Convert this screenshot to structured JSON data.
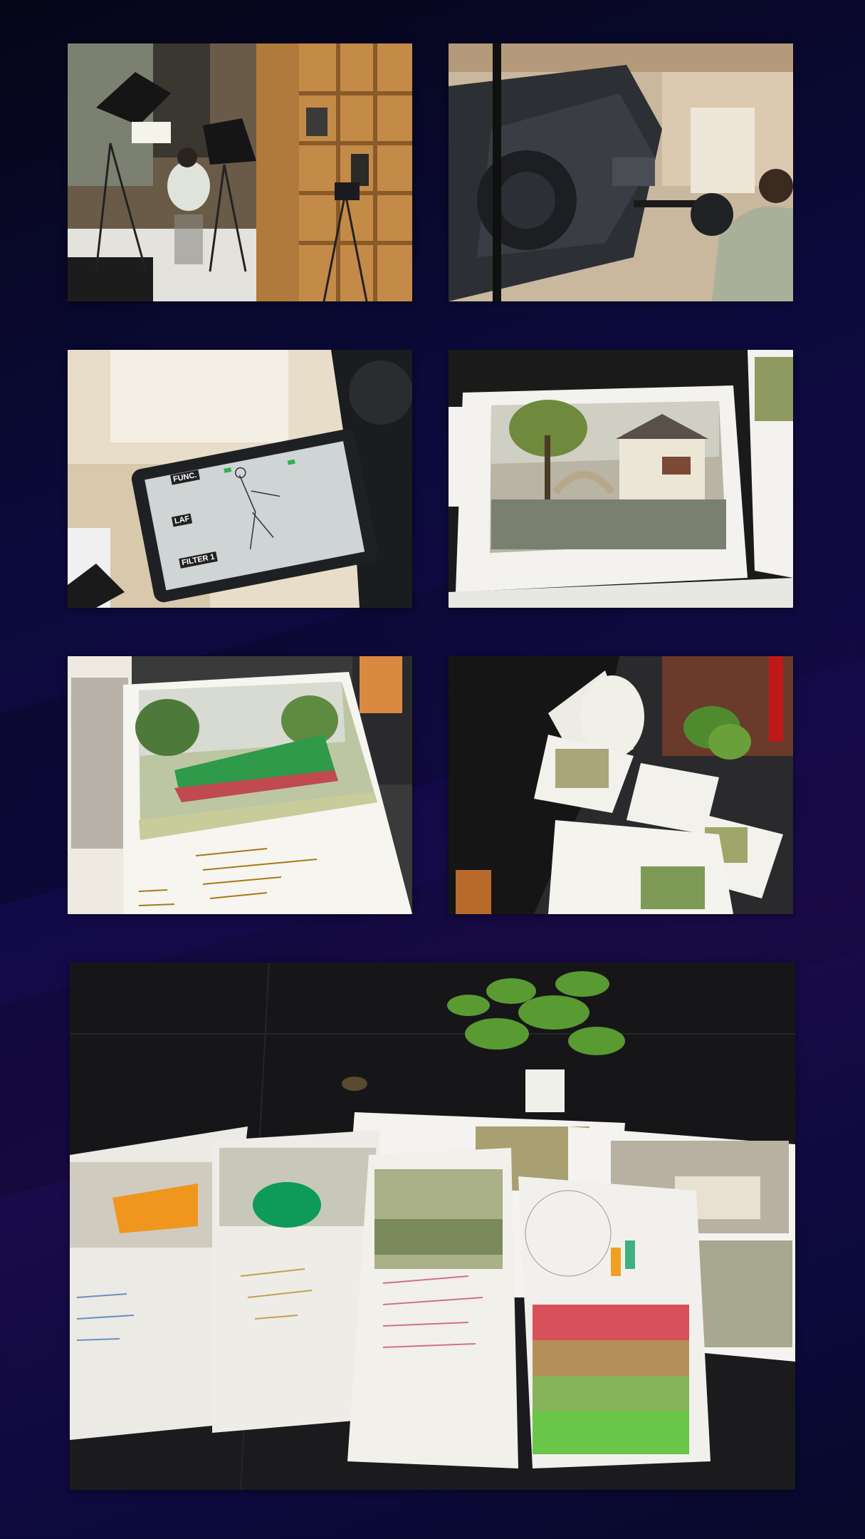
{
  "gallery": {
    "background_colors": [
      "#060618",
      "#120a48",
      "#1a0b4a"
    ],
    "photos": [
      {
        "name": "photo-studio-setup",
        "subject": "studio-lights-camera-tripod"
      },
      {
        "name": "photo-video-camera",
        "subject": "camcorder-recording-artist"
      },
      {
        "name": "photo-camera-screen",
        "subject": "camera-lcd-sketch"
      },
      {
        "name": "photo-village-painting",
        "subject": "gouache-bridge-village"
      },
      {
        "name": "photo-train-painting",
        "subject": "gouache-green-train"
      },
      {
        "name": "photo-desk-papers",
        "subject": "person-sorting-paintings"
      },
      {
        "name": "photo-table-artworks",
        "subject": "paintings-on-table-with-plant"
      }
    ],
    "screen_labels": {
      "func": "FUNC.",
      "laf": "LAF",
      "filter": "FILTER 1"
    }
  }
}
